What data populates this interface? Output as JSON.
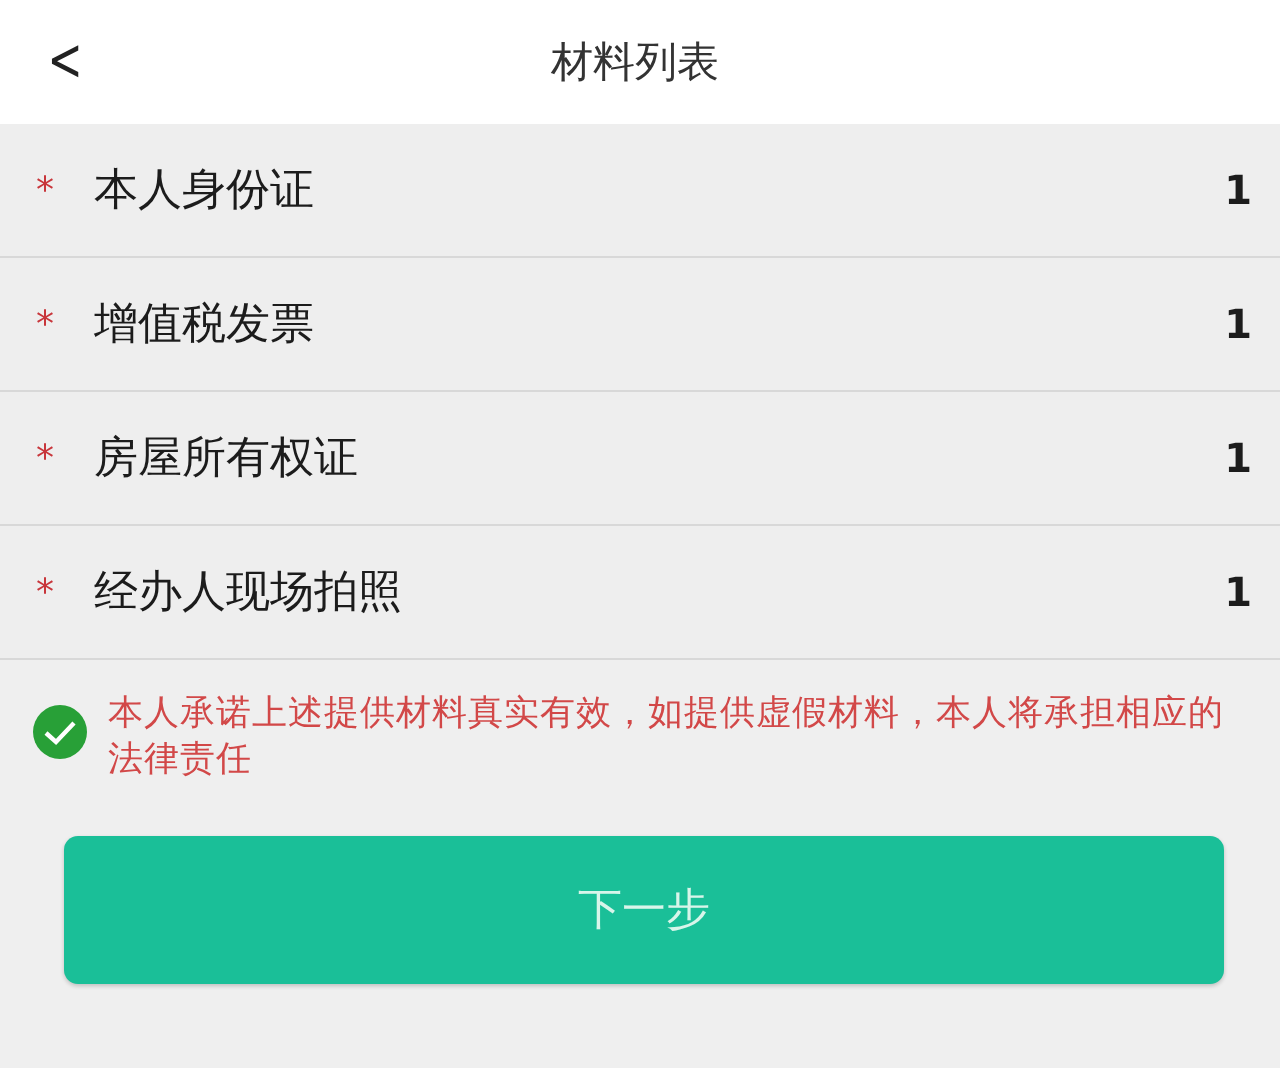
{
  "header": {
    "back": "<",
    "title": "材料列表"
  },
  "materials": [
    {
      "mark": "*",
      "label": "本人身份证",
      "count": "1"
    },
    {
      "mark": "*",
      "label": "增值税发票",
      "count": "1"
    },
    {
      "mark": "*",
      "label": "房屋所有权证",
      "count": "1"
    },
    {
      "mark": "*",
      "label": "经办人现场拍照",
      "count": "1"
    }
  ],
  "pledge": {
    "checked": true,
    "text": "本人承诺上述提供材料真实有效，如提供虚假材料，本人将承担相应的法律责任"
  },
  "next_button": "下一步"
}
